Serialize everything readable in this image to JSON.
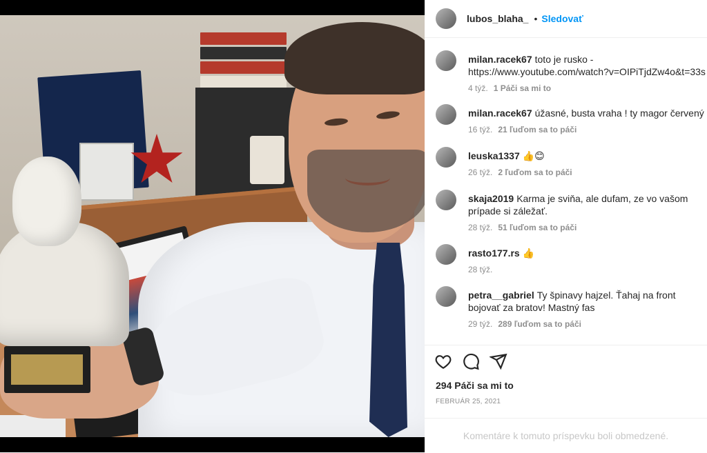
{
  "post": {
    "author": "lubos_blaha_",
    "separator": "•",
    "follow_label": "Sledovať"
  },
  "comments": [
    {
      "user": "milan.racek67",
      "text": "toto je rusko - https://www.youtube.com/watch?v=OIPiTjdZw4o&t=33s",
      "time": "4 týž.",
      "likes": "1 Páči sa mi to"
    },
    {
      "user": "milan.racek67",
      "text": "úžasné, busta vraha ! ty magor červený",
      "time": "16 týž.",
      "likes": "21 ľuďom sa to páči"
    },
    {
      "user": "leuska1337",
      "text": "👍😊",
      "time": "26 týž.",
      "likes": "2 ľuďom sa to páči"
    },
    {
      "user": "skaja2019",
      "text": "Karma je sviňa, ale dufam, ze vo vašom prípade si záležať.",
      "time": "28 týž.",
      "likes": "51 ľuďom sa to páči"
    },
    {
      "user": "rasto177.rs",
      "text": "👍",
      "time": "28 týž.",
      "likes": ""
    },
    {
      "user": "petra__gabriel",
      "text": "Ty špinavy hajzel. Ťahaj na front bojovať za bratov! Mastný fas",
      "time": "29 týž.",
      "likes": "289 ľuďom sa to páči"
    }
  ],
  "actions": {
    "icons": [
      "heart-icon",
      "comment-icon",
      "share-icon"
    ],
    "like_count": "294 Páči sa mi to",
    "date": "FEBRUÁR 25, 2021"
  },
  "footer": {
    "comments_disabled": "Komentáre k tomuto príspevku boli obmedzené."
  },
  "colors": {
    "link": "#0095f6",
    "text": "#262626",
    "muted": "#8e8e8e",
    "border": "#efefef"
  }
}
